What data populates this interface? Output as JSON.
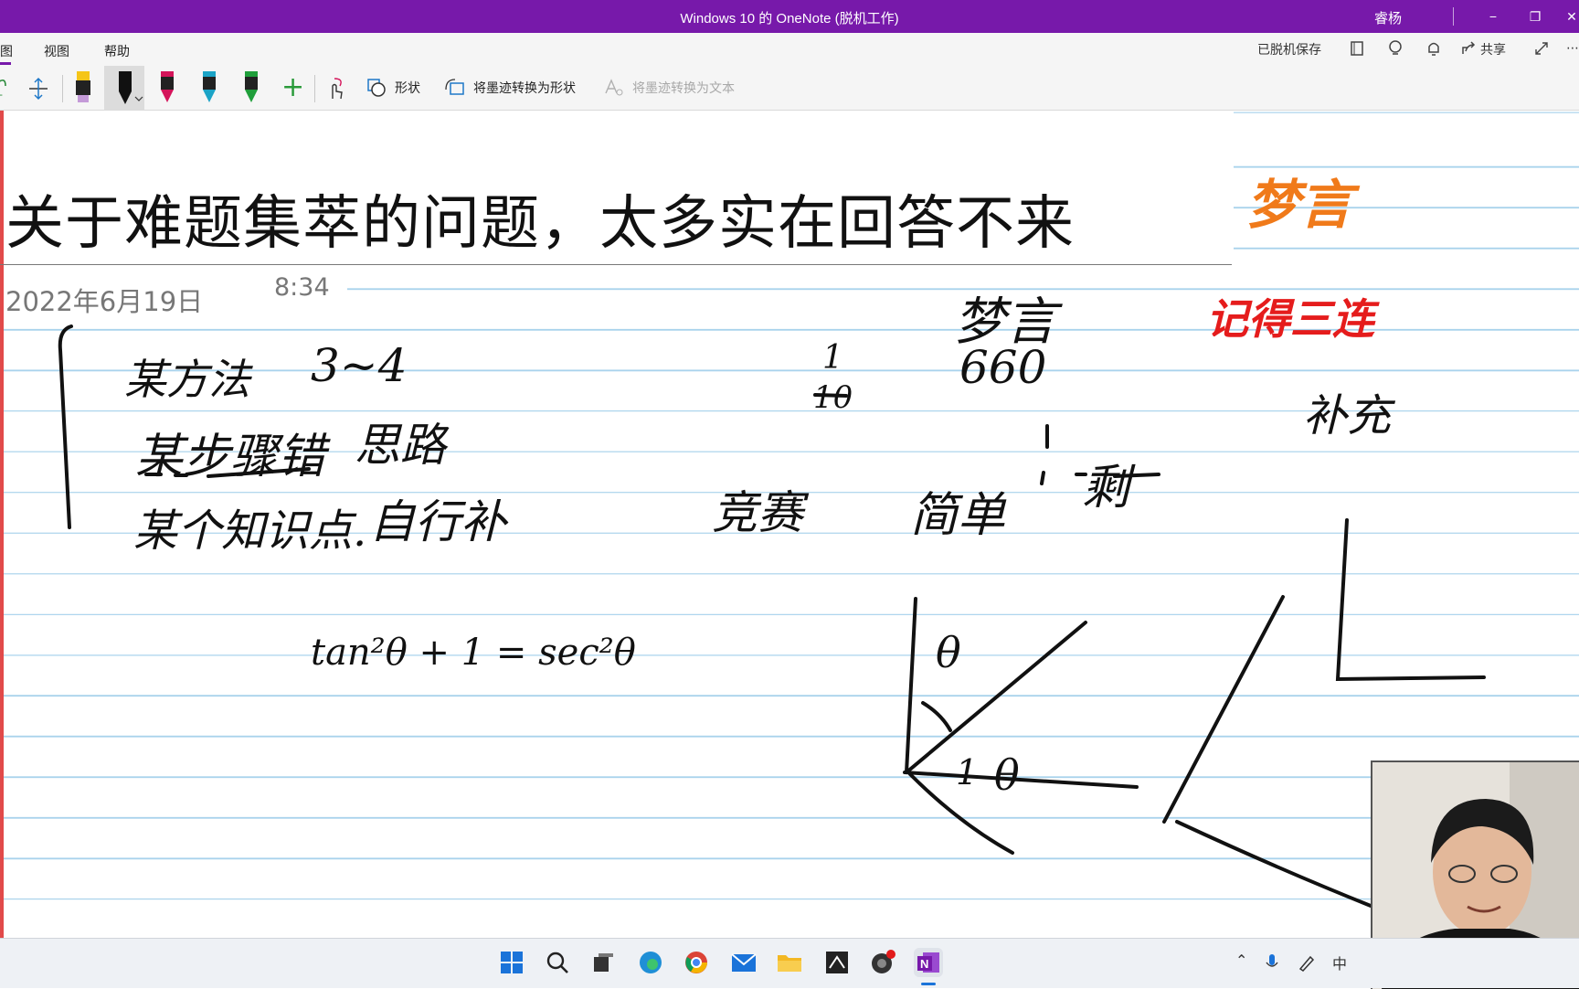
{
  "window": {
    "title": "Windows 10 的 OneNote (脱机工作)",
    "user": "睿杨",
    "minimize": "−",
    "restore": "❐",
    "close": "✕"
  },
  "tabs": {
    "partial": "图",
    "view": "视图",
    "help": "帮助"
  },
  "status": {
    "saved_offline": "已脱机保存",
    "share": "共享",
    "more": "⋯"
  },
  "toolbar": {
    "shapes": "形状",
    "ink_to_shape": "将墨迹转换为形状",
    "ink_to_text": "将墨迹转换为文本",
    "add_pen": "+"
  },
  "colors": {
    "accent": "#7719aa",
    "pen_yellow": "#f5c518",
    "pen_black": "#111111",
    "pen_magenta": "#d4145a",
    "pen_cyan": "#1ba3c6",
    "pen_green": "#1f9e3a",
    "ink_orange": "#f07a1a",
    "ink_red": "#e51c1c",
    "rule_blue": "#a9d3ec"
  },
  "page": {
    "title": "关于难题集萃的问题，太多实在回答不来",
    "date": "2022年6月19日",
    "time": "8:34"
  },
  "ink": {
    "orange_note": "梦言",
    "red_note": "记得三连",
    "dream": "梦言",
    "left_line1": "某方法",
    "left_line1_num": "3~4",
    "left_line2": "某步骤错",
    "left_line2_b": "思路",
    "left_line3": "某个知识点.",
    "left_line3_b": "自行补",
    "fraction_top": "1",
    "fraction_bottom": "10",
    "number_660": "660",
    "competition": "竞赛",
    "simple": "简单",
    "remainder": "剩",
    "supplement": "补充",
    "formula": "tan²θ + 1 = sec²θ",
    "theta1": "θ",
    "theta2": "θ",
    "one": "1"
  }
}
